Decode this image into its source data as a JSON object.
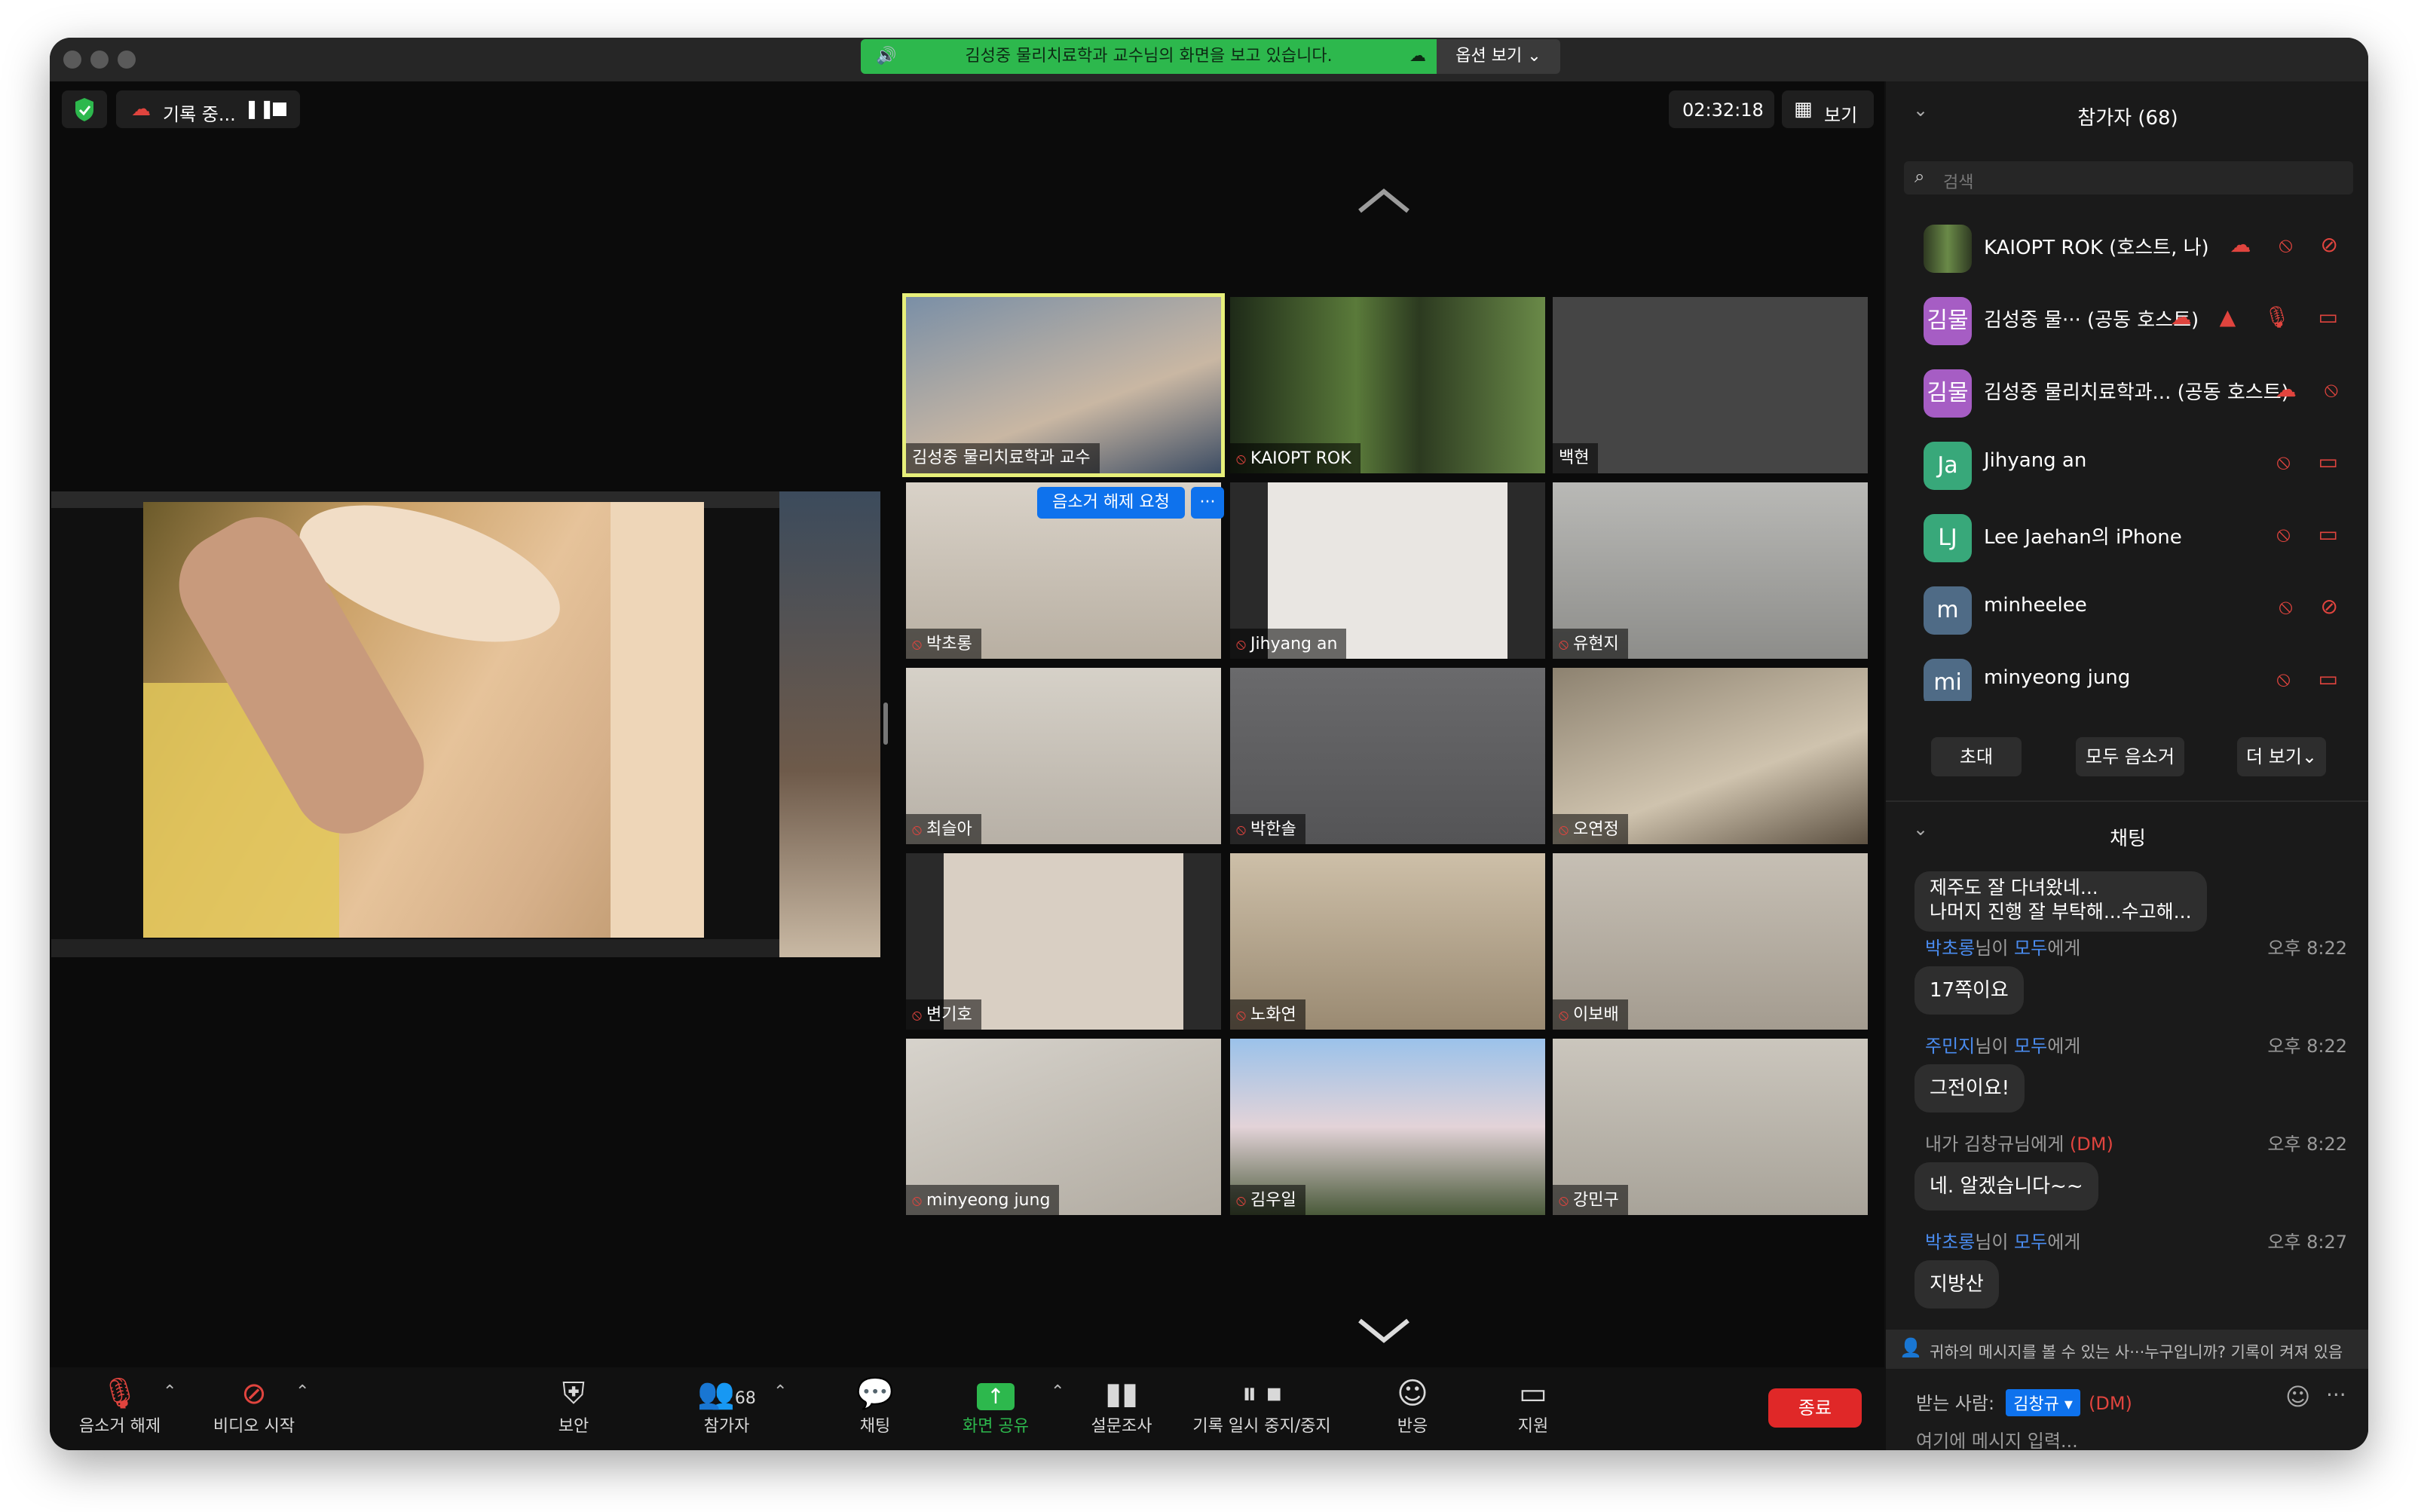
{
  "share_banner": {
    "text": "김성중 물리치료학과 교수님의 화면을 보고 있습니다.",
    "options": "옵션 보기 ⌄"
  },
  "recording": {
    "label": "기록 중..."
  },
  "timer": "02:32:18",
  "view_label": "보기",
  "tiles": [
    {
      "name": "김성중 물리치료학과 교수",
      "muted": false
    },
    {
      "name": "KAIOPT ROK",
      "muted": true
    },
    {
      "name": "백현",
      "muted": false
    },
    {
      "name": "박초롱",
      "muted": true
    },
    {
      "name": "Jihyang an",
      "muted": true
    },
    {
      "name": "유현지",
      "muted": true
    },
    {
      "name": "최슬아",
      "muted": true
    },
    {
      "name": "박한솔",
      "muted": true
    },
    {
      "name": "오연정",
      "muted": true
    },
    {
      "name": "변기호",
      "muted": true
    },
    {
      "name": "노화연",
      "muted": true
    },
    {
      "name": "이보배",
      "muted": true
    },
    {
      "name": "minyeong jung",
      "muted": true
    },
    {
      "name": "김우일",
      "muted": true
    },
    {
      "name": "강민구",
      "muted": true
    }
  ],
  "unmute_request": "음소거 해제 요청",
  "tile_more": "···",
  "participants": {
    "title": "참가자 (68)",
    "search_placeholder": "검색",
    "list": [
      {
        "initials": "",
        "name": "KAIOPT ROK (호스트, 나)",
        "color": "#4a5a3a"
      },
      {
        "initials": "김물",
        "name": "김성중 물···   (공동 호스트)",
        "color": "#a65dc4"
      },
      {
        "initials": "김물",
        "name": "김성중 물리치료학과...  (공동 호스트)",
        "color": "#a65dc4"
      },
      {
        "initials": "Ja",
        "name": "Jihyang an",
        "color": "#38a87a"
      },
      {
        "initials": "LJ",
        "name": "Lee Jaehan의 iPhone",
        "color": "#38a87a"
      },
      {
        "initials": "m",
        "name": "minheelee",
        "color": "#4f6b86"
      },
      {
        "initials": "mi",
        "name": "minyeong jung",
        "color": "#4f6b86"
      }
    ],
    "buttons": {
      "invite": "초대",
      "mute_all": "모두 음소거",
      "more": "더 보기⌄"
    }
  },
  "chat": {
    "title": "채팅",
    "first_message": "제주도 잘 다녀왔네...\n나머지 진행 잘 부탁해...수고해...",
    "messages": [
      {
        "sender": "박초롱",
        "suffix": "님이 ",
        "target": "모두",
        "target_suffix": "에게",
        "time": "오후 8:22",
        "text": "17쪽이요"
      },
      {
        "sender": "주민지",
        "suffix": "님이 ",
        "target": "모두",
        "target_suffix": "에게",
        "time": "오후 8:22",
        "text": "그전이요!"
      },
      {
        "sender": "내가 김창규님에게",
        "suffix": " ",
        "target": "(DM)",
        "target_suffix": "",
        "time": "오후 8:22",
        "text": "네. 알겠습니다~~"
      },
      {
        "sender": "박초롱",
        "suffix": "님이 ",
        "target": "모두",
        "target_suffix": "에게",
        "time": "오후 8:27",
        "text": "지방산"
      }
    ],
    "notice": "귀하의 메시지를 볼 수 있는 사···누구입니까? 기록이 켜져 있음",
    "to_label": "받는 사람:",
    "to_value": "김창규 ▾",
    "dm": "(DM)",
    "input_placeholder": "여기에 메시지 입력..."
  },
  "toolbar": {
    "unmute": "음소거 해제",
    "video": "비디오 시작",
    "security": "보안",
    "participants": "참가자",
    "participants_count": "68",
    "chat": "채팅",
    "share": "화면 공유",
    "poll": "설문조사",
    "record": "기록 일시 중지/중지",
    "react": "반응",
    "support": "지원",
    "end": "종료"
  },
  "colors": {
    "accent_green": "#2db84d",
    "accent_blue": "#0e72ed",
    "end_red": "#e02828",
    "mute_red": "#e0443e",
    "chat_blue": "#4a8cf0",
    "dm_red": "#e0443e"
  }
}
